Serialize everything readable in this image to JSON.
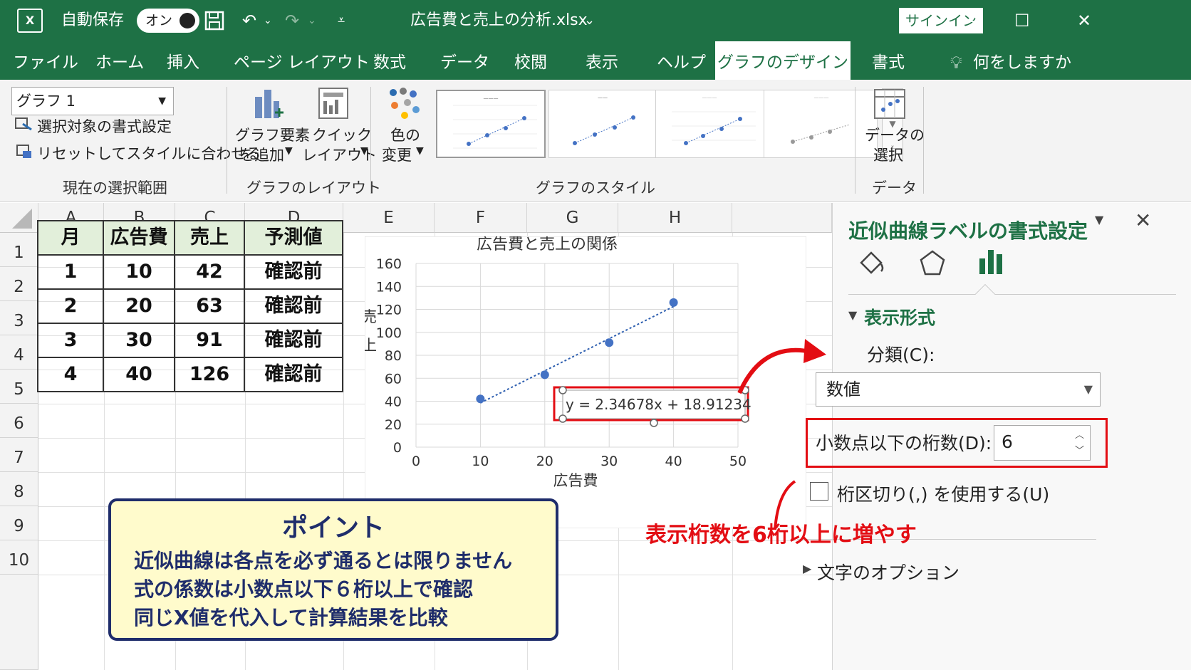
{
  "titlebar": {
    "app_logo": "X",
    "autosave_label": "自動保存",
    "autosave_state": "オン",
    "filename": "広告費と売上の分析.xlsx",
    "signin_label": "サインイン"
  },
  "menu": {
    "items": [
      "ファイル",
      "ホーム",
      "挿入",
      "ページ レイアウト",
      "数式",
      "データ",
      "校閲",
      "表示",
      "ヘルプ",
      "グラフのデザイン",
      "書式"
    ],
    "active": "グラフのデザイン",
    "tell_me": "何をしますか"
  },
  "ribbon": {
    "selection_combo": "グラフ 1",
    "format_selection": "選択対象の書式設定",
    "reset_style": "リセットしてスタイルに合わせる",
    "group_current_selection": "現在の選択範囲",
    "add_element_line1": "グラフ要素",
    "add_element_line2": "を追加",
    "quick_layout_line1": "クイック",
    "quick_layout_line2": "レイアウト",
    "group_layout": "グラフのレイアウト",
    "change_color_line1": "色の",
    "change_color_line2": "変更",
    "group_styles": "グラフのスタイル",
    "select_data_line1": "データの",
    "select_data_line2": "選択",
    "group_data": "データ"
  },
  "grid": {
    "columns": [
      "A",
      "B",
      "C",
      "D",
      "E",
      "F",
      "G",
      "H"
    ],
    "rows": [
      "1",
      "2",
      "3",
      "4",
      "5",
      "6",
      "7",
      "8",
      "9",
      "10"
    ],
    "table_headers": [
      "月",
      "広告費",
      "売上",
      "予測値"
    ],
    "table_rows": [
      [
        "1",
        "10",
        "42",
        "確認前"
      ],
      [
        "2",
        "20",
        "63",
        "確認前"
      ],
      [
        "3",
        "30",
        "91",
        "確認前"
      ],
      [
        "4",
        "40",
        "126",
        "確認前"
      ]
    ]
  },
  "chart_data": {
    "type": "scatter",
    "title": "広告費と売上の関係",
    "xlabel": "広告費",
    "ylabel": "売上",
    "x": [
      10,
      20,
      30,
      40
    ],
    "y": [
      42,
      63,
      91,
      126
    ],
    "xlim": [
      0,
      50
    ],
    "ylim": [
      0,
      160
    ],
    "xticks": [
      0,
      10,
      20,
      30,
      40,
      50
    ],
    "yticks": [
      0,
      20,
      40,
      60,
      80,
      100,
      120,
      140,
      160
    ],
    "grid": true,
    "trendline": "linear",
    "trendline_label": "y = 2.34678x + 18.91234",
    "point_color": "#4472c4"
  },
  "callout": {
    "title": "ポイント",
    "lines": [
      "近似曲線は各点を必ず通るとは限りません",
      "式の係数は小数点以下６桁以上で確認",
      "同じX値を代入して計算結果を比較"
    ]
  },
  "pane": {
    "title": "近似曲線ラベルの書式設定",
    "section_number": "表示形式",
    "category_label": "分類(C):",
    "category_value": "数値",
    "decimals_label": "小数点以下の桁数(D):",
    "decimals_value": "6",
    "separator_label": "桁区切り(,) を使用する(U)",
    "section_text_options": "文字のオプション"
  },
  "annotation": {
    "text": "表示桁数を6桁以上に増やす",
    "color": "#e30d13"
  },
  "colors": {
    "excel_green": "#1e7145",
    "header_fill": "#e2efda",
    "callout_fill": "#fffbcc",
    "callout_border": "#1f2d6b",
    "highlight_red": "#e30d13"
  }
}
